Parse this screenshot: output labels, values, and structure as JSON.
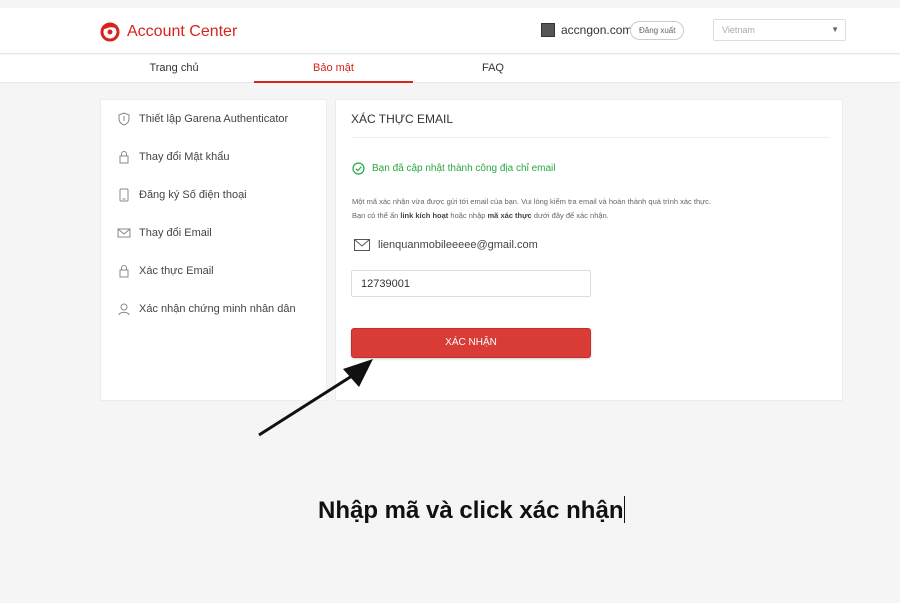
{
  "header": {
    "app_title": "Account Center",
    "username": "accngon.com",
    "logout_label": "Đăng xuất",
    "language": "Vietnam",
    "brand_color": "#d9231d"
  },
  "nav": {
    "tabs": [
      {
        "label": "Trang chủ",
        "active": false
      },
      {
        "label": "Bảo mật",
        "active": true
      },
      {
        "label": "FAQ",
        "active": false
      }
    ]
  },
  "sidebar": {
    "items": [
      {
        "label": "Thiết lập Garena Authenticator",
        "icon": "shield-icon"
      },
      {
        "label": "Thay đổi Mật khẩu",
        "icon": "lock-icon"
      },
      {
        "label": "Đăng ký Số điện thoại",
        "icon": "phone-icon"
      },
      {
        "label": "Thay đổi Email",
        "icon": "mail-icon"
      },
      {
        "label": "Xác thực Email",
        "icon": "lock-icon"
      },
      {
        "label": "Xác nhận chứng minh nhân dân",
        "icon": "id-card-icon"
      }
    ]
  },
  "main": {
    "title": "XÁC THỰC EMAIL",
    "success_message": "Bạn đã cập nhật thành công địa chỉ email",
    "desc_line1": "Một mã xác nhận vừa được gửi tới email của bạn. Vui lòng kiểm tra email và hoàn thành quá trình xác thực.",
    "desc_line2_a": "Bạn có thể ấn ",
    "desc_line2_b": "link kích hoạt",
    "desc_line2_c": " hoặc nhập ",
    "desc_line2_d": "mã xác thực",
    "desc_line2_e": " dưới đây để xác nhận.",
    "email": "lienquanmobileeeee@gmail.com",
    "code_value": "12739001",
    "confirm_label": "XÁC NHẬN",
    "success_color": "#27a844",
    "button_color": "#d93b37"
  },
  "annotation": {
    "caption": "Nhập mã và click xác nhận"
  }
}
